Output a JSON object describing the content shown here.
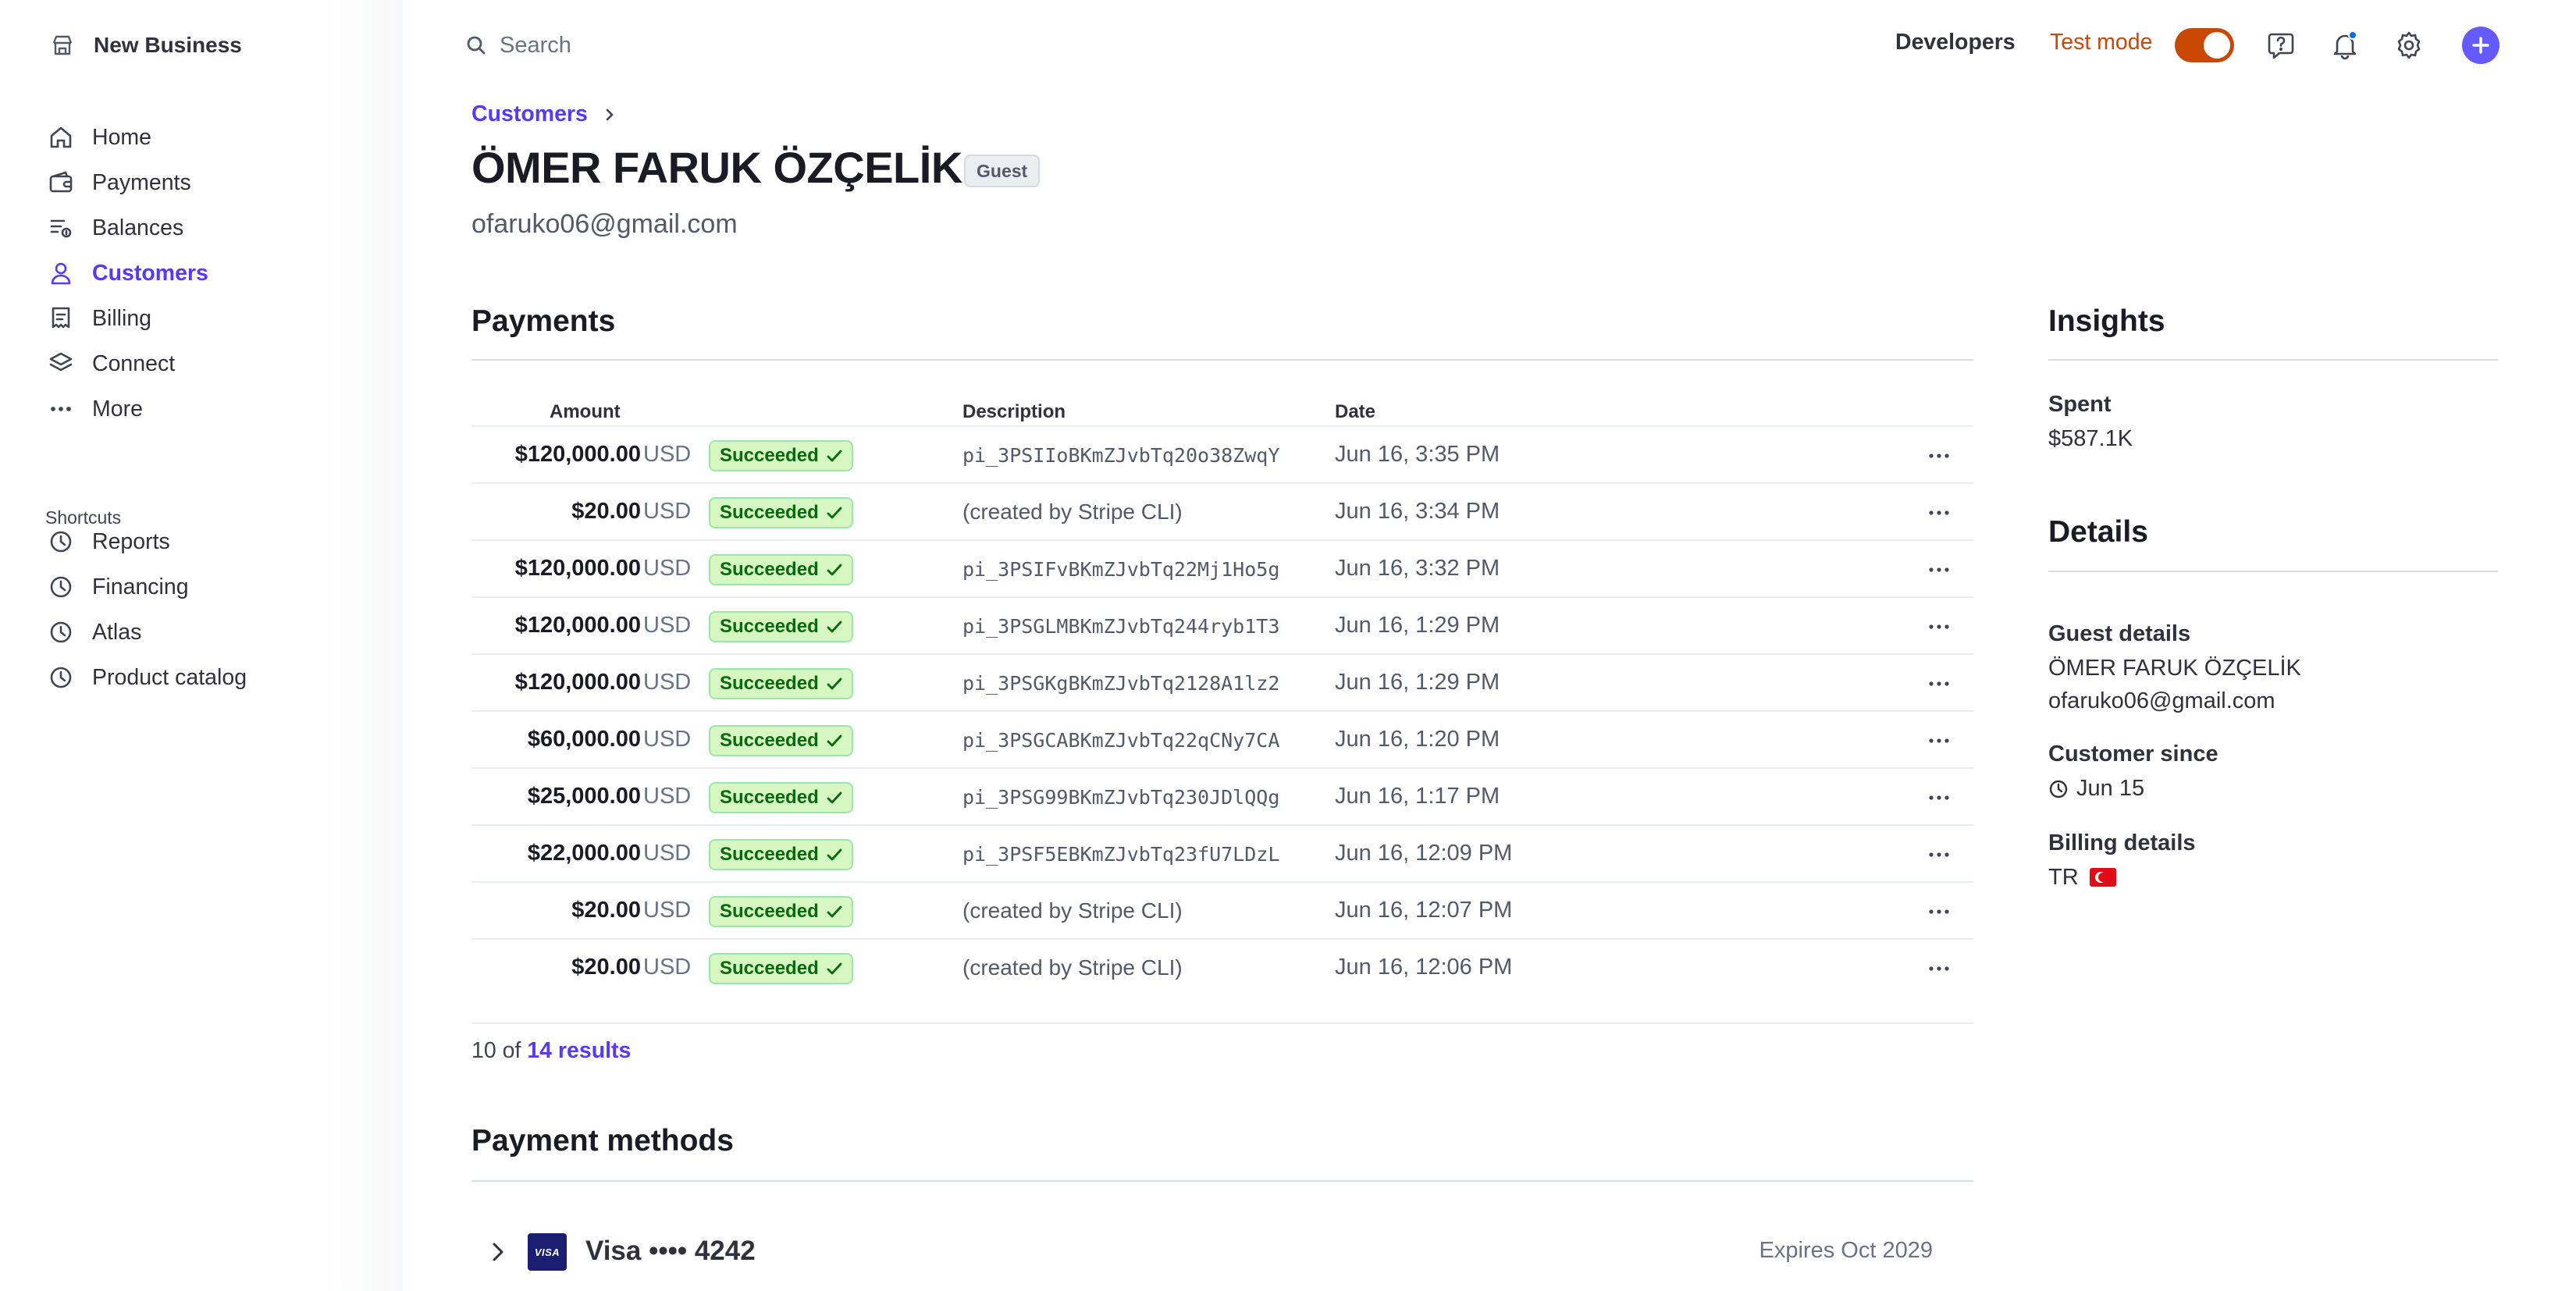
{
  "account": {
    "name": "New Business"
  },
  "nav": {
    "items": [
      {
        "label": "Home",
        "icon": "home-icon"
      },
      {
        "label": "Payments",
        "icon": "wallet-icon"
      },
      {
        "label": "Balances",
        "icon": "balances-icon"
      },
      {
        "label": "Customers",
        "icon": "person-icon",
        "active": true
      },
      {
        "label": "Billing",
        "icon": "billing-icon"
      },
      {
        "label": "Connect",
        "icon": "layers-icon"
      },
      {
        "label": "More",
        "icon": "ellipsis-icon"
      }
    ],
    "shortcuts_label": "Shortcuts",
    "shortcuts": [
      {
        "label": "Reports",
        "icon": "clock-icon"
      },
      {
        "label": "Financing",
        "icon": "clock-icon"
      },
      {
        "label": "Atlas",
        "icon": "clock-icon"
      },
      {
        "label": "Product catalog",
        "icon": "clock-icon"
      }
    ]
  },
  "topbar": {
    "search_placeholder": "Search",
    "developers": "Developers",
    "test_mode": "Test mode",
    "test_mode_on": true
  },
  "header": {
    "breadcrumb": "Customers",
    "title": "ÖMER FARUK ÖZÇELİK",
    "badge": "Guest",
    "email": "ofaruko06@gmail.com"
  },
  "payments": {
    "title": "Payments",
    "columns": {
      "amount": "Amount",
      "description": "Description",
      "date": "Date"
    },
    "rows": [
      {
        "amount": "$120,000.00",
        "currency": "USD",
        "status": "Succeeded",
        "description": "pi_3PSIIoBKmZJvbTq20o38ZwqY",
        "mono": true,
        "date": "Jun 16, 3:35 PM"
      },
      {
        "amount": "$20.00",
        "currency": "USD",
        "status": "Succeeded",
        "description": "(created by Stripe CLI)",
        "mono": false,
        "date": "Jun 16, 3:34 PM"
      },
      {
        "amount": "$120,000.00",
        "currency": "USD",
        "status": "Succeeded",
        "description": "pi_3PSIFvBKmZJvbTq22Mj1Ho5g",
        "mono": true,
        "date": "Jun 16, 3:32 PM"
      },
      {
        "amount": "$120,000.00",
        "currency": "USD",
        "status": "Succeeded",
        "description": "pi_3PSGLMBKmZJvbTq244ryb1T3",
        "mono": true,
        "date": "Jun 16, 1:29 PM"
      },
      {
        "amount": "$120,000.00",
        "currency": "USD",
        "status": "Succeeded",
        "description": "pi_3PSGKgBKmZJvbTq2128A1lz2",
        "mono": true,
        "date": "Jun 16, 1:29 PM"
      },
      {
        "amount": "$60,000.00",
        "currency": "USD",
        "status": "Succeeded",
        "description": "pi_3PSGCABKmZJvbTq22qCNy7CA",
        "mono": true,
        "date": "Jun 16, 1:20 PM"
      },
      {
        "amount": "$25,000.00",
        "currency": "USD",
        "status": "Succeeded",
        "description": "pi_3PSG99BKmZJvbTq230JDlQQg",
        "mono": true,
        "date": "Jun 16, 1:17 PM"
      },
      {
        "amount": "$22,000.00",
        "currency": "USD",
        "status": "Succeeded",
        "description": "pi_3PSF5EBKmZJvbTq23fU7LDzL",
        "mono": true,
        "date": "Jun 16, 12:09 PM"
      },
      {
        "amount": "$20.00",
        "currency": "USD",
        "status": "Succeeded",
        "description": "(created by Stripe CLI)",
        "mono": false,
        "date": "Jun 16, 12:07 PM"
      },
      {
        "amount": "$20.00",
        "currency": "USD",
        "status": "Succeeded",
        "description": "(created by Stripe CLI)",
        "mono": false,
        "date": "Jun 16, 12:06 PM"
      }
    ],
    "results_prefix": "10 of",
    "results_link": "14 results"
  },
  "payment_methods": {
    "title": "Payment methods",
    "card_brand": "VISA",
    "card_label": "Visa •••• 4242",
    "expires": "Expires Oct 2029"
  },
  "insights": {
    "title": "Insights",
    "spent_label": "Spent",
    "spent_value": "$587.1K"
  },
  "details": {
    "title": "Details",
    "guest_label": "Guest details",
    "guest_name": "ÖMER FARUK ÖZÇELİK",
    "guest_email": "ofaruko06@gmail.com",
    "since_label": "Customer since",
    "since_value": "Jun 15",
    "billing_label": "Billing details",
    "billing_country": "TR"
  },
  "colors": {
    "accent": "#533afd",
    "test_mode": "#c84801",
    "success_bg": "#d7f7c2",
    "success_text": "#05690d"
  }
}
